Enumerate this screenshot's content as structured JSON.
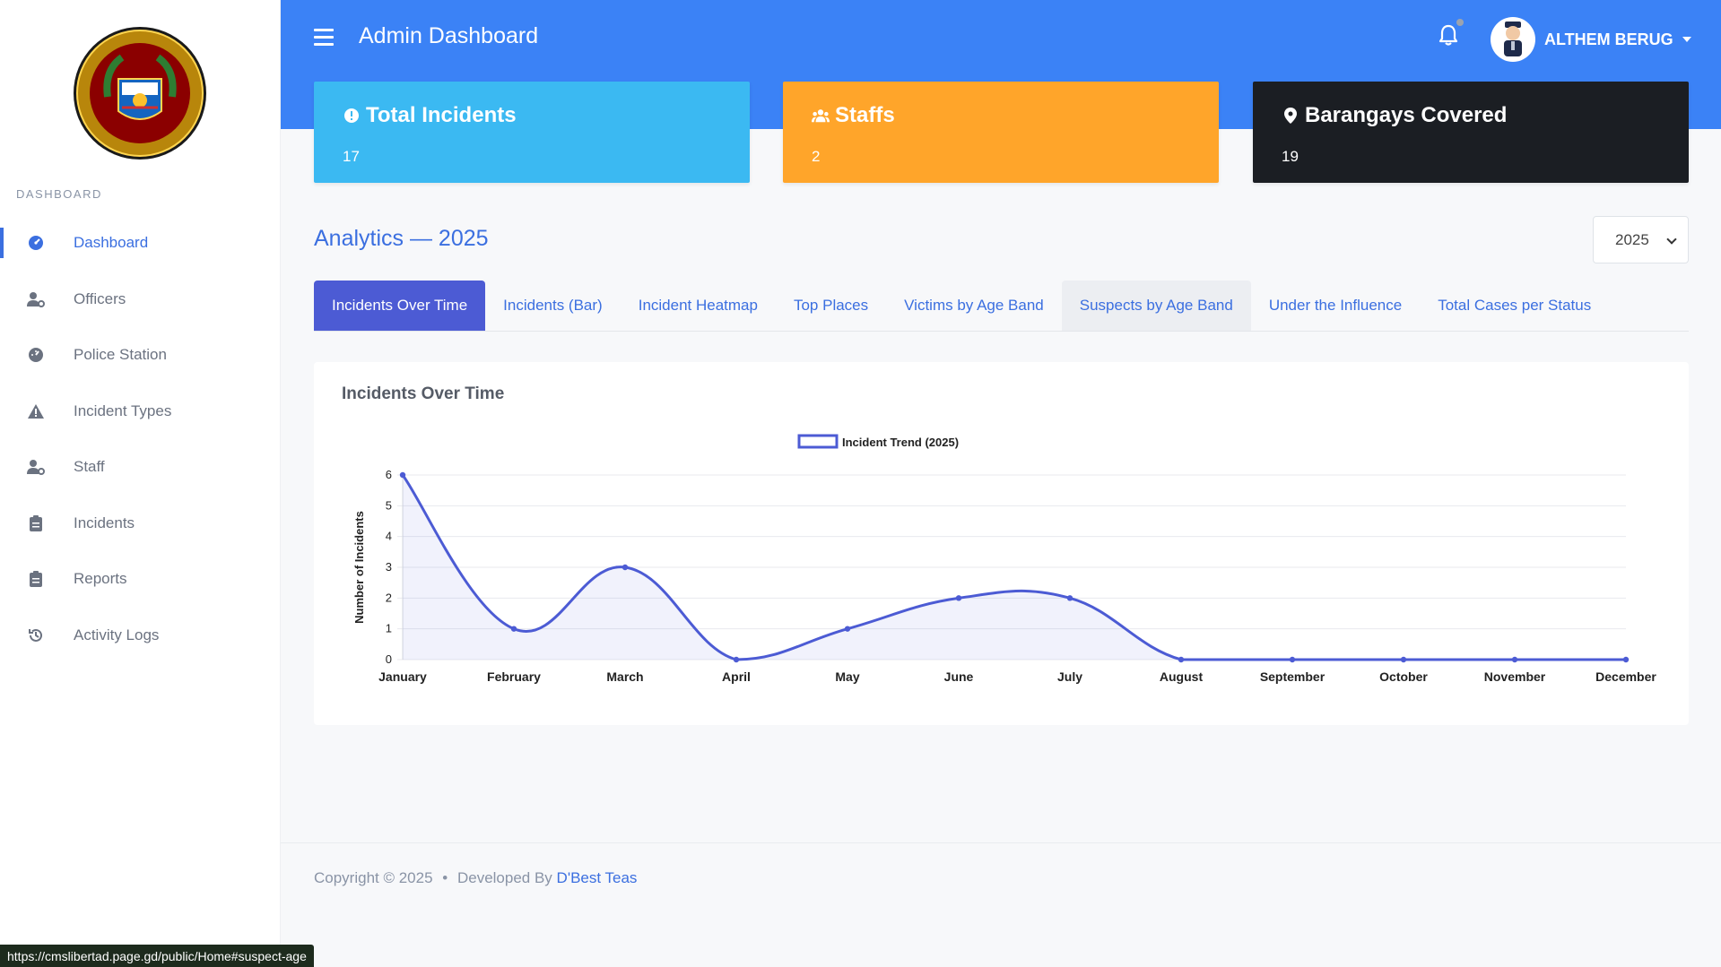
{
  "sidebar": {
    "section_label": "DASHBOARD",
    "items": [
      {
        "label": "Dashboard",
        "icon": "dashboard-icon",
        "active": true
      },
      {
        "label": "Officers",
        "icon": "user-gear-icon",
        "active": false
      },
      {
        "label": "Police Station",
        "icon": "gauge-icon",
        "active": false
      },
      {
        "label": "Incident Types",
        "icon": "warning-icon",
        "active": false
      },
      {
        "label": "Staff",
        "icon": "user-gear-icon",
        "active": false
      },
      {
        "label": "Incidents",
        "icon": "clipboard-icon",
        "active": false
      },
      {
        "label": "Reports",
        "icon": "clipboard-icon",
        "active": false
      },
      {
        "label": "Activity Logs",
        "icon": "history-icon",
        "active": false
      }
    ]
  },
  "header": {
    "title": "Admin Dashboard",
    "user_name": "ALTHEM BERUG"
  },
  "stats": [
    {
      "title": "Total Incidents",
      "value": "17",
      "icon": "info-circle-icon",
      "color": "#3bb9f2"
    },
    {
      "title": "Staffs",
      "value": "2",
      "icon": "users-icon",
      "color": "#ffa52a"
    },
    {
      "title": "Barangays Covered",
      "value": "19",
      "icon": "map-pin-icon",
      "color": "#1b1e23"
    }
  ],
  "analytics": {
    "title": "Analytics — 2025",
    "year": "2025",
    "tabs": [
      {
        "label": "Incidents Over Time",
        "state": "active"
      },
      {
        "label": "Incidents (Bar)",
        "state": ""
      },
      {
        "label": "Incident Heatmap",
        "state": ""
      },
      {
        "label": "Top Places",
        "state": ""
      },
      {
        "label": "Victims by Age Band",
        "state": ""
      },
      {
        "label": "Suspects by Age Band",
        "state": "hover"
      },
      {
        "label": "Under the Influence",
        "state": ""
      },
      {
        "label": "Total Cases per Status",
        "state": ""
      }
    ],
    "chart_card_title": "Incidents Over Time"
  },
  "chart_data": {
    "type": "line",
    "categories": [
      "January",
      "February",
      "March",
      "April",
      "May",
      "June",
      "July",
      "August",
      "September",
      "October",
      "November",
      "December"
    ],
    "series": [
      {
        "name": "Incident Trend (2025)",
        "values": [
          6,
          1,
          3,
          0,
          1,
          2,
          2,
          0,
          0,
          0,
          0,
          0
        ],
        "color": "#4c5bd4"
      }
    ],
    "ylabel": "Number of Incidents",
    "xlabel": "",
    "ylim": [
      0,
      6
    ],
    "yticks": [
      "0",
      "1",
      "2",
      "3",
      "4",
      "5",
      "6"
    ],
    "grid": true,
    "legend": "top-center",
    "fill": true
  },
  "footer": {
    "copyright": "Copyright © 2025",
    "separator": "•",
    "developed_by": "Developed By",
    "developer": "D'Best Teas"
  },
  "status_url": "https://cmslibertad.page.gd/public/Home#suspect-age",
  "colors": {
    "primary": "#3b82f6",
    "accent": "#3b6fe0",
    "tab_active": "#4c5bd4"
  }
}
